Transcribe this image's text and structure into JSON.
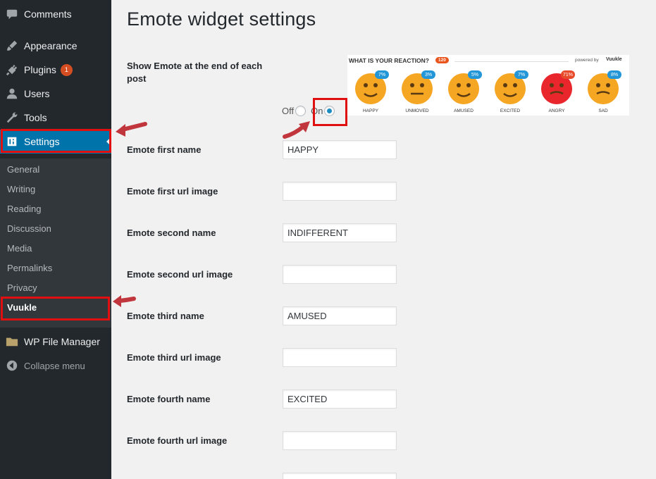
{
  "sidebar": {
    "items": [
      {
        "label": "Comments",
        "icon": "comments-icon"
      },
      {
        "label": "Appearance",
        "icon": "appearance-icon"
      },
      {
        "label": "Plugins",
        "icon": "plugins-icon",
        "badge": "1"
      },
      {
        "label": "Users",
        "icon": "users-icon"
      },
      {
        "label": "Tools",
        "icon": "tools-icon"
      },
      {
        "label": "Settings",
        "icon": "settings-icon"
      }
    ],
    "submenu": [
      "General",
      "Writing",
      "Reading",
      "Discussion",
      "Media",
      "Permalinks",
      "Privacy",
      "Vuukle"
    ],
    "file_manager": "WP File Manager",
    "collapse": "Collapse menu"
  },
  "page": {
    "title": "Emote widget settings",
    "show_emote_label": "Show Emote at the end of each post",
    "radio_off": "Off",
    "radio_on": "On",
    "selected_option": "On"
  },
  "form": [
    {
      "label": "Emote first name",
      "value": "HAPPY"
    },
    {
      "label": "Emote first url image",
      "value": ""
    },
    {
      "label": "Emote second name",
      "value": "INDIFFERENT"
    },
    {
      "label": "Emote second url image",
      "value": ""
    },
    {
      "label": "Emote third name",
      "value": "AMUSED"
    },
    {
      "label": "Emote third url image",
      "value": ""
    },
    {
      "label": "Emote fourth name",
      "value": "EXCITED"
    },
    {
      "label": "Emote fourth url image",
      "value": ""
    }
  ],
  "preview": {
    "title": "WHAT IS YOUR REACTION?",
    "count": "120",
    "powered": "powered by",
    "logo": "Vuukle",
    "emotes": [
      {
        "label": "HAPPY",
        "pct": "7%",
        "color": "#f5a623"
      },
      {
        "label": "UNMOVED",
        "pct": "3%",
        "color": "#f5a623"
      },
      {
        "label": "AMUSED",
        "pct": "5%",
        "color": "#f5a623"
      },
      {
        "label": "EXCITED",
        "pct": "7%",
        "color": "#f5a623"
      },
      {
        "label": "ANGRY",
        "pct": "71%",
        "color": "#e8262b"
      },
      {
        "label": "SAD",
        "pct": "8%",
        "color": "#f5a623"
      }
    ]
  },
  "colors": {
    "sidebar": "#23282d",
    "active": "#0073aa",
    "highlight": "#e01010",
    "badge": "#d54e21"
  }
}
